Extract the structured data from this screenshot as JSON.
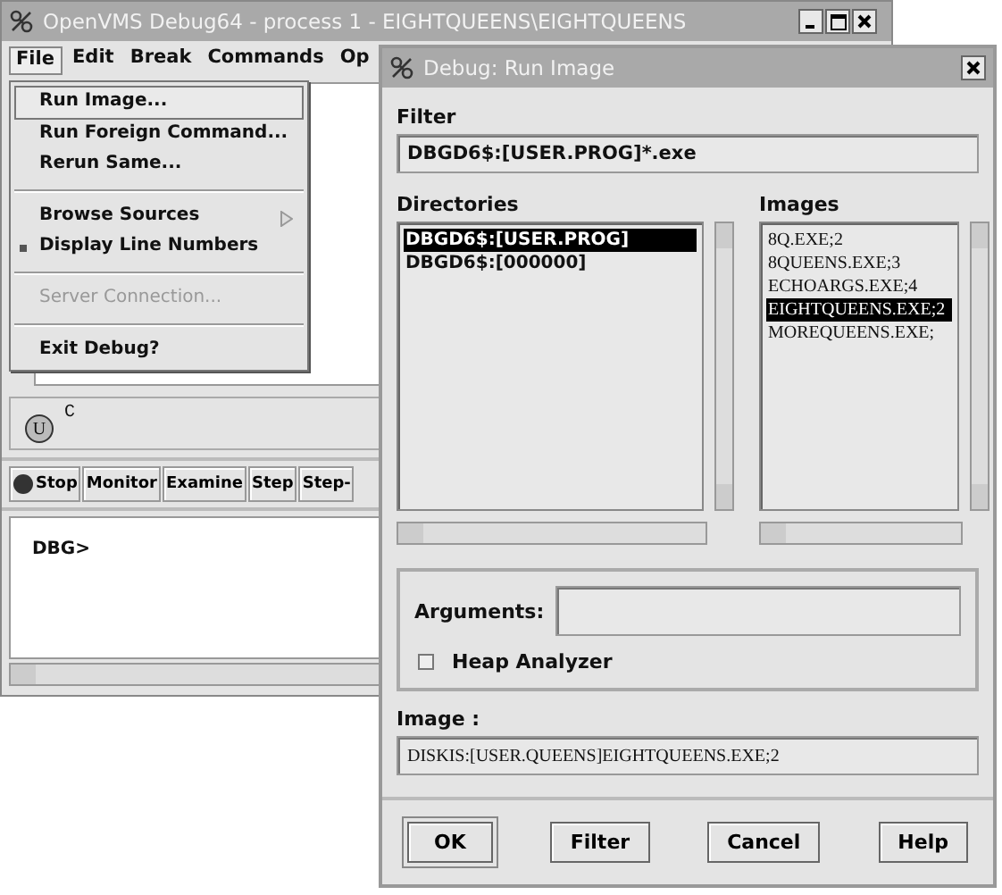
{
  "main_window": {
    "title": "OpenVMS Debug64 - process 1 - EIGHTQUEENS\\EIGHTQUEENS",
    "menu_bar": [
      {
        "label": "File",
        "selected": true
      },
      {
        "label": "Edit",
        "selected": false
      },
      {
        "label": "Break",
        "selected": false
      },
      {
        "label": "Commands",
        "selected": false
      },
      {
        "label": "Op",
        "selected": false
      }
    ],
    "file_menu": [
      {
        "kind": "item",
        "label": "Run Image...",
        "selected": true,
        "disabled": false
      },
      {
        "kind": "item",
        "label": "Run Foreign Command...",
        "selected": false,
        "disabled": false
      },
      {
        "kind": "item",
        "label": "Rerun Same...",
        "selected": false,
        "disabled": false
      },
      {
        "kind": "separator"
      },
      {
        "kind": "submenu",
        "label": "Browse Sources",
        "selected": false,
        "disabled": false
      },
      {
        "kind": "check",
        "label": "Display Line Numbers",
        "selected": false,
        "disabled": false,
        "checked": true
      },
      {
        "kind": "separator"
      },
      {
        "kind": "item",
        "label": "Server Connection...",
        "selected": false,
        "disabled": true
      },
      {
        "kind": "separator"
      },
      {
        "kind": "item",
        "label": "Exit Debug?",
        "selected": false,
        "disabled": false
      }
    ],
    "status": {
      "badge": "U",
      "text": "C"
    },
    "toolbar": [
      {
        "kind": "stop",
        "label": "Stop"
      },
      {
        "kind": "button",
        "label": "Monitor"
      },
      {
        "kind": "button",
        "label": "Examine"
      },
      {
        "kind": "button",
        "label": "Step"
      },
      {
        "kind": "button",
        "label": "Step-"
      }
    ],
    "console": {
      "prompt": "DBG>"
    }
  },
  "dialog": {
    "title": "Debug: Run Image",
    "filter": {
      "label": "Filter",
      "value": "DBGD6$:[USER.PROG]*.exe"
    },
    "directories": {
      "label": "Directories",
      "items": [
        {
          "text": "DBGD6$:[USER.PROG]",
          "selected": true
        },
        {
          "text": "DBGD6$:[000000]",
          "selected": false
        }
      ]
    },
    "images": {
      "label": "Images",
      "items": [
        {
          "text": "8Q.EXE;2",
          "selected": false
        },
        {
          "text": "8QUEENS.EXE;3",
          "selected": false
        },
        {
          "text": "ECHOARGS.EXE;4",
          "selected": false
        },
        {
          "text": "EIGHTQUEENS.EXE;2",
          "selected": true
        },
        {
          "text": "MOREQUEENS.EXE;",
          "selected": false
        }
      ]
    },
    "arguments": {
      "label": "Arguments:"
    },
    "heap_analyzer": {
      "label": "Heap Analyzer",
      "checked": false
    },
    "image": {
      "label": "Image :",
      "value": "DISKIS:[USER.QUEENS]EIGHTQUEENS.EXE;2"
    },
    "buttons": [
      {
        "label": "OK",
        "default": true
      },
      {
        "label": "Filter",
        "default": false
      },
      {
        "label": "Cancel",
        "default": false
      },
      {
        "label": "Help",
        "default": false
      }
    ]
  }
}
